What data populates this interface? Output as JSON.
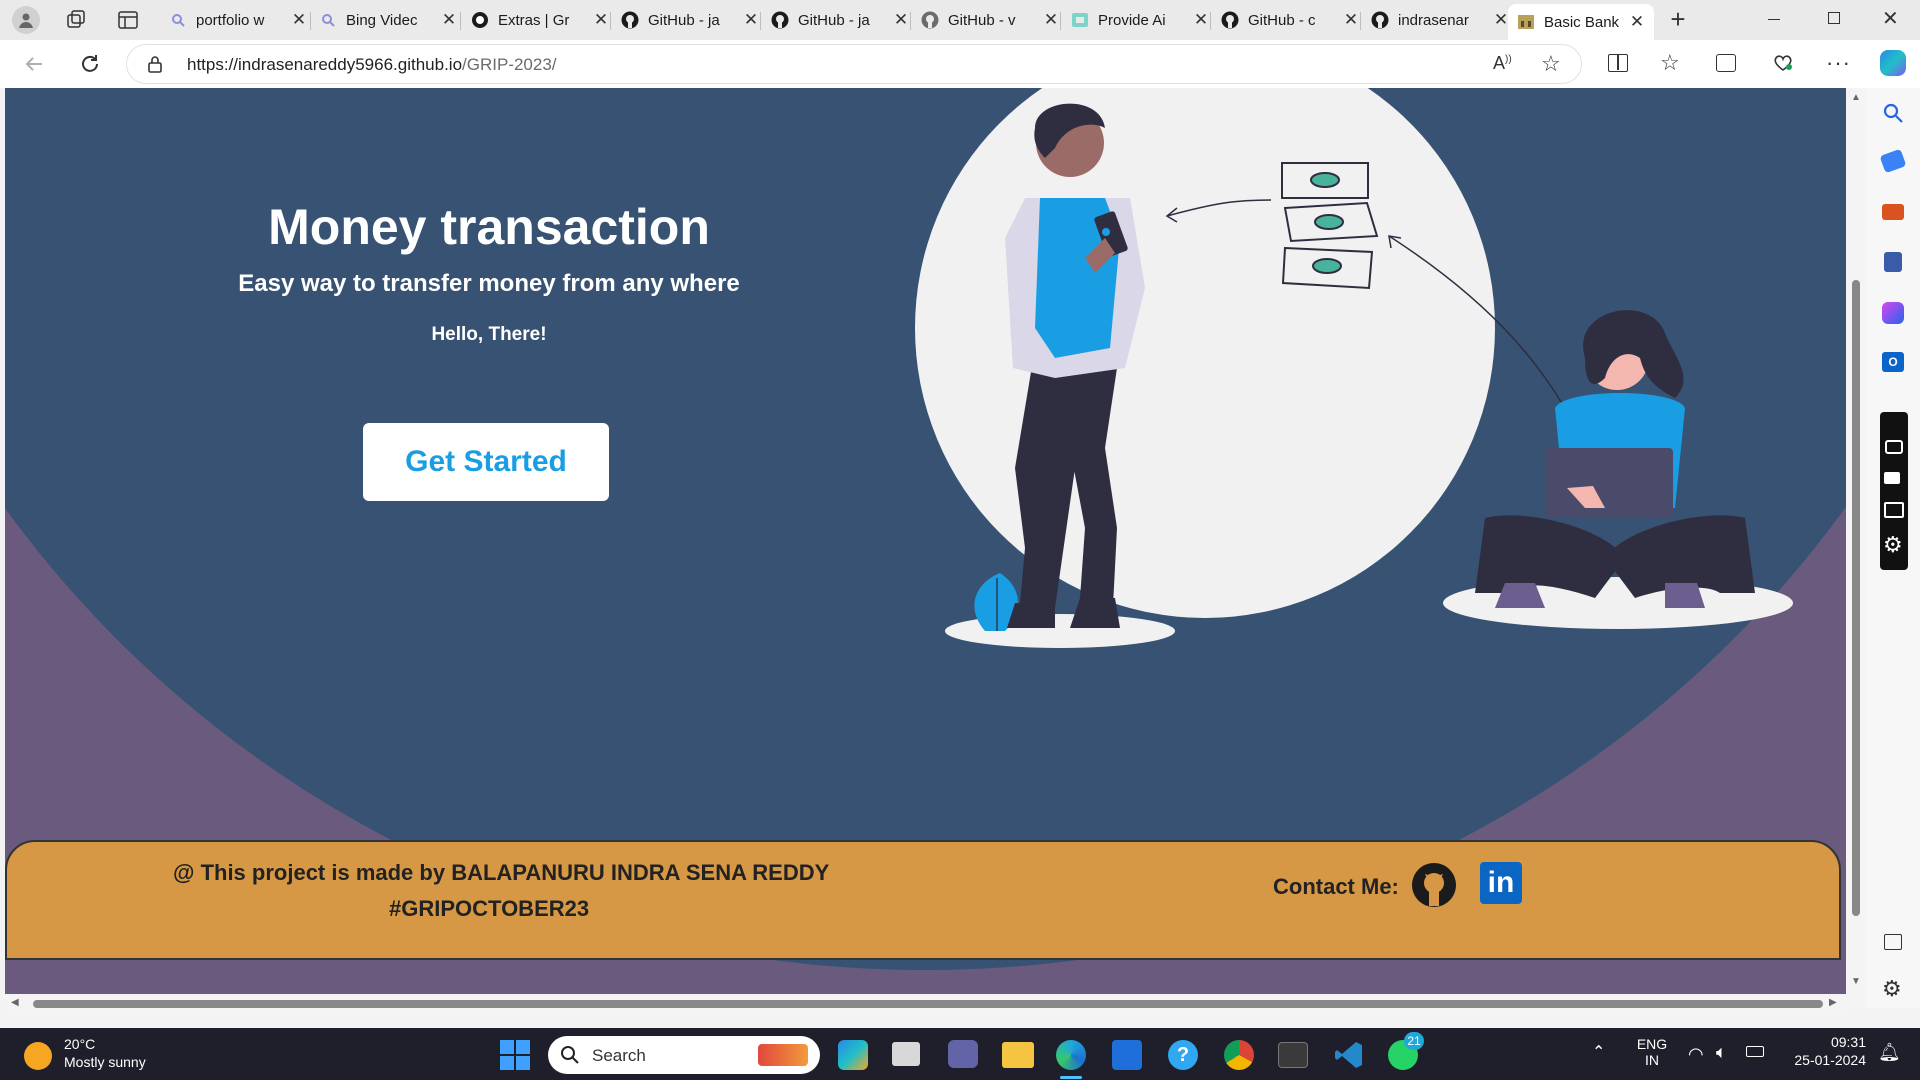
{
  "browser": {
    "tabs": [
      {
        "title": "portfolio w",
        "icon": "search-icon"
      },
      {
        "title": "Bing Videc",
        "icon": "search-icon"
      },
      {
        "title": "Extras | Gr",
        "icon": "extras-icon"
      },
      {
        "title": "GitHub - ja",
        "icon": "github-icon"
      },
      {
        "title": "GitHub - ja",
        "icon": "github-icon"
      },
      {
        "title": "GitHub - v",
        "icon": "github-icon"
      },
      {
        "title": "Provide Ai",
        "icon": "provide-icon"
      },
      {
        "title": "GitHub - c",
        "icon": "github-icon"
      },
      {
        "title": "indrasenar",
        "icon": "github-icon"
      },
      {
        "title": "Basic Bank",
        "icon": "bank-icon",
        "active": true
      }
    ],
    "url": "https://indrasenareddy5966.github.io/GRIP-2023/",
    "url_host": "https://indrasenareddy5966.github.io",
    "url_path": "/GRIP-2023/"
  },
  "hero": {
    "title": "Money transaction",
    "subtitle": "Easy way to transfer money from any where",
    "greeting": "Hello, There!",
    "cta_label": "Get Started"
  },
  "footer": {
    "credit": "@ This project is made by BALAPANURU INDRA SENA REDDY",
    "hashtag": "#GRIPOCTOBER23",
    "contact_label": "Contact Me:"
  },
  "taskbar": {
    "weather_temp": "20°C",
    "weather_desc": "Mostly sunny",
    "search_placeholder": "Search",
    "whatsapp_badge": "21",
    "lang_top": "ENG",
    "lang_bottom": "IN",
    "time": "09:31",
    "date": "25-01-2024"
  },
  "colors": {
    "hero_bg": "#375273",
    "page_bg": "#6a5a7d",
    "footer_bg": "#d69844",
    "accent": "#1a9ee3",
    "cta_bg": "#ffffff"
  }
}
